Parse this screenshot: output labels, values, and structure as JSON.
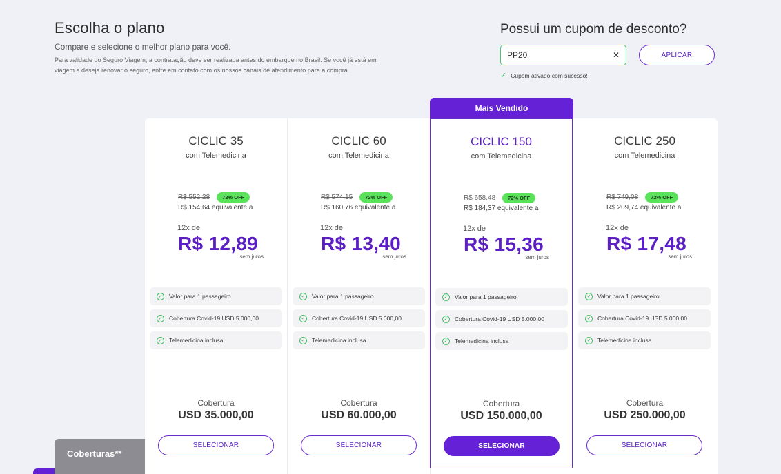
{
  "header": {
    "title": "Escolha o plano",
    "subtitle": "Compare e selecione o melhor plano para você.",
    "note_before": "Para validade do Seguro Viagem, a contratação deve ser realizada ",
    "note_underlined": "antes",
    "note_after": " do embarque no Brasil. Se você já está em viagem e deseja renovar o seguro, entre em contato com os nossos canais de atendimento para a compra."
  },
  "coupon": {
    "title": "Possui um cupom de desconto?",
    "value": "PP20",
    "clear_icon": "close-icon",
    "apply_label": "APLICAR",
    "success_message": "Cupom ativado com sucesso!"
  },
  "badge": {
    "label": "Mais Vendido"
  },
  "plans": [
    {
      "name": "CICLIC 35",
      "subtitle": "com Telemedicina",
      "old_price": "R$ 552,28",
      "discount": "72% OFF",
      "total_line": "R$ 154,64 equivalente a",
      "installments": "12x de",
      "price": "R$ 12,89",
      "interest": "sem juros",
      "features": [
        "Valor para 1 passageiro",
        "Cobertura Covid-19 USD 5.000,00",
        "Telemedicina inclusa"
      ],
      "coverage_label": "Cobertura",
      "coverage_value": "USD 35.000,00",
      "select_label": "SELECIONAR"
    },
    {
      "name": "CICLIC 60",
      "subtitle": "com Telemedicina",
      "old_price": "R$ 574,15",
      "discount": "72% OFF",
      "total_line": "R$ 160,76 equivalente a",
      "installments": "12x de",
      "price": "R$ 13,40",
      "interest": "sem juros",
      "features": [
        "Valor para 1 passageiro",
        "Cobertura Covid-19 USD 5.000,00",
        "Telemedicina inclusa"
      ],
      "coverage_label": "Cobertura",
      "coverage_value": "USD 60.000,00",
      "select_label": "SELECIONAR"
    },
    {
      "name": "CICLIC 150",
      "subtitle": "com Telemedicina",
      "old_price": "R$ 658,48",
      "discount": "72% OFF",
      "total_line": "R$ 184,37 equivalente a",
      "installments": "12x de",
      "price": "R$ 15,36",
      "interest": "sem juros",
      "features": [
        "Valor para 1 passageiro",
        "Cobertura Covid-19 USD 5.000,00",
        "Telemedicina inclusa"
      ],
      "coverage_label": "Cobertura",
      "coverage_value": "USD 150.000,00",
      "select_label": "SELECIONAR"
    },
    {
      "name": "CICLIC 250",
      "subtitle": "com Telemedicina",
      "old_price": "R$ 749,08",
      "discount": "72% OFF",
      "total_line": "R$ 209,74 equivalente a",
      "installments": "12x de",
      "price": "R$ 17,48",
      "interest": "sem juros",
      "features": [
        "Valor para 1 passageiro",
        "Cobertura Covid-19 USD 5.000,00",
        "Telemedicina inclusa"
      ],
      "coverage_label": "Cobertura",
      "coverage_value": "USD 250.000,00",
      "select_label": "SELECIONAR"
    }
  ],
  "footer": {
    "coverages_tab": "Coberturas**"
  },
  "colors": {
    "accent": "#6521d6",
    "success": "#3ebf64",
    "discount_badge": "#5be25b",
    "background": "#eff1f6"
  }
}
